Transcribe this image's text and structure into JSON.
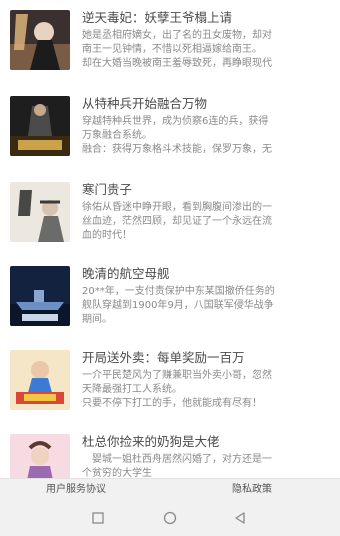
{
  "books": [
    {
      "title": "逆天毒妃：妖孽王爷榻上请",
      "desc": [
        "她是丞相府嫡女，出了名的丑女废物，却对",
        "南王一见钟情，不惜以死相逼嫁给南王。",
        "却在大婚当晚被南王羞辱致死，再睁眼现代"
      ],
      "cover_colors": [
        "#2a2a2a",
        "#d9b37a"
      ]
    },
    {
      "title": "从特种兵开始融合万物",
      "desc": [
        "穿越特种兵世界，成为侦察6连的兵，获得",
        "万象融合系统。",
        "融合：获得万象格斗术技能，保罗万象，无"
      ],
      "cover_colors": [
        "#1e1e1e",
        "#c9a24a"
      ]
    },
    {
      "title": "寒门贵子",
      "desc": [
        "徐佑从昏迷中睁开眼，看到胸腹间渗出的一",
        "丝血迹，茫然四顾，却见证了一个永远在流",
        "血的时代！"
      ],
      "cover_colors": [
        "#e8e4dc",
        "#6b6b6b"
      ]
    },
    {
      "title": "晚清的航空母舰",
      "desc": [
        "20**年，一支付责保护中东某国撤侨任务的",
        "舰队穿越到1900年9月，八国联军侵华战争",
        "期间。"
      ],
      "cover_colors": [
        "#13233f",
        "#6c8fc4"
      ]
    },
    {
      "title": "开局送外卖：每单奖励一百万",
      "desc": [
        "一介平民楚风为了赚兼职当外卖小哥，忽然",
        "天降最强打工人系统。",
        "只要不停下打工的手，他就能成有尽有！"
      ],
      "cover_colors": [
        "#d94836",
        "#f3c648"
      ]
    },
    {
      "title": "杜总你捡来的奶狗是大佬",
      "desc": [
        "　婴城一姐杜西舟居然闪婚了，对方还是一",
        "个贫穷的大学生"
      ],
      "cover_colors": [
        "#f2c9d6",
        "#9c6ab0"
      ]
    }
  ],
  "footer": {
    "user_agreement": "用户服务协议",
    "privacy_policy": "隐私政策"
  },
  "navbar": {
    "recent_icon": "square-icon",
    "home_icon": "circle-icon",
    "back_icon": "triangle-back-icon"
  }
}
